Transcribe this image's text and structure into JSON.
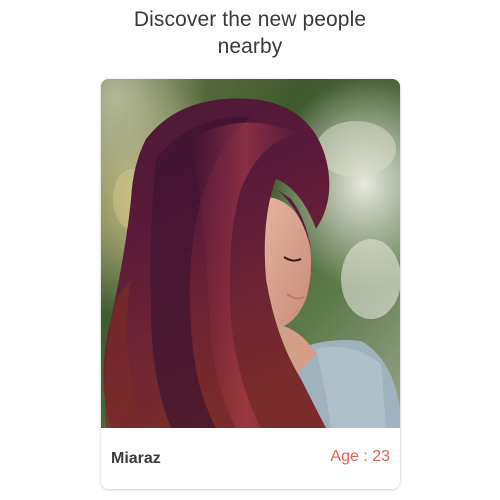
{
  "header": {
    "title_line1": "Discover the new people",
    "title_line2": "nearby"
  },
  "profile_card": {
    "name": "Miaraz",
    "age_label": "Age : 23",
    "accent_color": "#e4605c"
  }
}
